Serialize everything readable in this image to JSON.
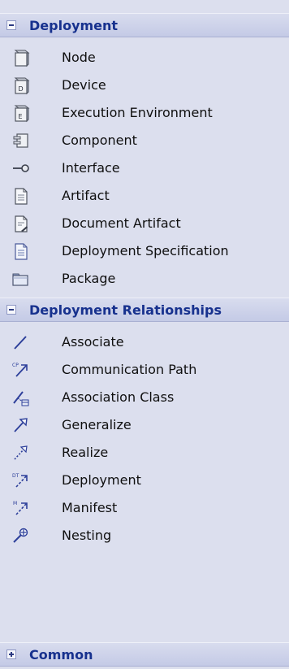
{
  "sections": [
    {
      "title": "Deployment",
      "expanded": true,
      "items": [
        {
          "label": "Node",
          "icon": "node-icon"
        },
        {
          "label": "Device",
          "icon": "device-icon"
        },
        {
          "label": "Execution Environment",
          "icon": "execution-environment-icon"
        },
        {
          "label": "Component",
          "icon": "component-icon"
        },
        {
          "label": "Interface",
          "icon": "interface-icon"
        },
        {
          "label": "Artifact",
          "icon": "artifact-icon"
        },
        {
          "label": "Document Artifact",
          "icon": "document-artifact-icon"
        },
        {
          "label": "Deployment Specification",
          "icon": "deployment-specification-icon"
        },
        {
          "label": "Package",
          "icon": "package-icon"
        }
      ]
    },
    {
      "title": "Deployment Relationships",
      "expanded": true,
      "items": [
        {
          "label": "Associate",
          "icon": "associate-icon"
        },
        {
          "label": "Communication Path",
          "icon": "communication-path-icon"
        },
        {
          "label": "Association Class",
          "icon": "association-class-icon"
        },
        {
          "label": "Generalize",
          "icon": "generalize-icon"
        },
        {
          "label": "Realize",
          "icon": "realize-icon"
        },
        {
          "label": "Deployment",
          "icon": "deployment-icon"
        },
        {
          "label": "Manifest",
          "icon": "manifest-icon"
        },
        {
          "label": "Nesting",
          "icon": "nesting-icon"
        }
      ]
    },
    {
      "title": "Common",
      "expanded": false,
      "items": []
    }
  ],
  "icon_text": {
    "device": "D",
    "execution_environment": "E",
    "communication_path": "CP",
    "deployment": "DT",
    "manifest": "M"
  },
  "colors": {
    "background": "#dcdfee",
    "section_title": "#17318e",
    "icon_blue": "#2d3f9a",
    "icon_gray": "#6a6f80"
  }
}
